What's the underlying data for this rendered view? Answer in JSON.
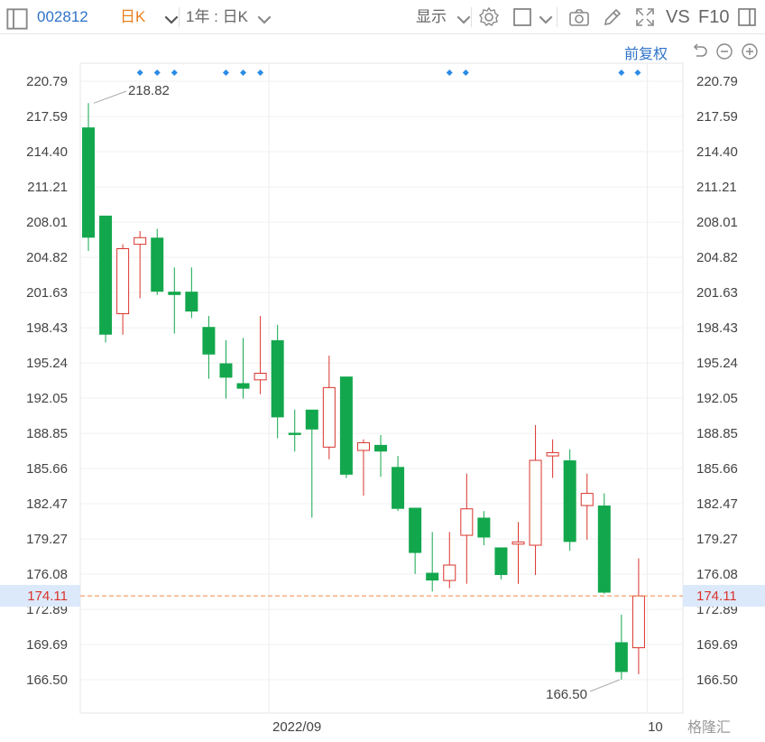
{
  "toolbar": {
    "stock_code": "002812",
    "period": "日K",
    "range": "1年 : 日K",
    "display_label": "显示",
    "vs_label": "VS",
    "f10_label": "F10"
  },
  "adjust_label": "前复权",
  "watermark": "格隆汇",
  "colors": {
    "up": "#d9342b",
    "down": "#13a74d",
    "current_line": "#f0884a",
    "marker": "#2b8be6"
  },
  "chart_data": {
    "type": "candlestick",
    "ylim": [
      165.0,
      222.3
    ],
    "y_ticks": [
      "220.79",
      "217.59",
      "214.40",
      "211.21",
      "208.01",
      "204.82",
      "201.63",
      "198.43",
      "195.24",
      "192.05",
      "188.85",
      "185.66",
      "182.47",
      "179.27",
      "176.08",
      "172.89",
      "169.69",
      "166.50"
    ],
    "x_labels": [
      {
        "label": "2022/09",
        "index": 10.5
      },
      {
        "label": "10",
        "index": 32.5
      }
    ],
    "current_price": "174.11",
    "max_label": "218.82",
    "min_label": "166.50",
    "markers_at": [
      3,
      4,
      5,
      8,
      9,
      10,
      21,
      22,
      31,
      32
    ],
    "candles": [
      {
        "o": 216.6,
        "h": 218.8,
        "l": 205.4,
        "c": 206.6
      },
      {
        "o": 208.6,
        "h": 208.6,
        "l": 197.1,
        "c": 197.8
      },
      {
        "o": 199.7,
        "h": 206.0,
        "l": 197.8,
        "c": 205.6
      },
      {
        "o": 206.0,
        "h": 207.2,
        "l": 201.1,
        "c": 206.6
      },
      {
        "o": 206.6,
        "h": 207.4,
        "l": 201.4,
        "c": 201.7
      },
      {
        "o": 201.7,
        "h": 203.9,
        "l": 197.9,
        "c": 201.4
      },
      {
        "o": 201.7,
        "h": 203.9,
        "l": 199.3,
        "c": 199.9
      },
      {
        "o": 198.5,
        "h": 199.5,
        "l": 193.8,
        "c": 196.0
      },
      {
        "o": 195.2,
        "h": 197.3,
        "l": 192.0,
        "c": 193.9
      },
      {
        "o": 193.4,
        "h": 197.5,
        "l": 192.0,
        "c": 192.9
      },
      {
        "o": 193.7,
        "h": 199.5,
        "l": 192.4,
        "c": 194.3
      },
      {
        "o": 197.3,
        "h": 198.7,
        "l": 188.4,
        "c": 190.3
      },
      {
        "o": 188.9,
        "h": 191.0,
        "l": 187.2,
        "c": 188.7
      },
      {
        "o": 191.0,
        "h": 191.0,
        "l": 181.2,
        "c": 189.2
      },
      {
        "o": 187.6,
        "h": 195.9,
        "l": 186.5,
        "c": 193.0
      },
      {
        "o": 194.0,
        "h": 194.0,
        "l": 184.8,
        "c": 185.1
      },
      {
        "o": 187.3,
        "h": 188.3,
        "l": 183.2,
        "c": 188.0
      },
      {
        "o": 187.8,
        "h": 188.7,
        "l": 184.9,
        "c": 187.2
      },
      {
        "o": 185.8,
        "h": 186.8,
        "l": 181.8,
        "c": 182.0
      },
      {
        "o": 182.1,
        "h": 182.1,
        "l": 176.1,
        "c": 178.0
      },
      {
        "o": 176.2,
        "h": 179.9,
        "l": 174.5,
        "c": 175.5
      },
      {
        "o": 175.5,
        "h": 179.9,
        "l": 174.8,
        "c": 176.9
      },
      {
        "o": 179.6,
        "h": 185.2,
        "l": 175.2,
        "c": 182.0
      },
      {
        "o": 181.2,
        "h": 181.8,
        "l": 178.7,
        "c": 179.4
      },
      {
        "o": 178.5,
        "h": 178.5,
        "l": 175.6,
        "c": 176.0
      },
      {
        "o": 178.8,
        "h": 180.8,
        "l": 175.2,
        "c": 179.0
      },
      {
        "o": 178.7,
        "h": 189.6,
        "l": 176.0,
        "c": 186.4
      },
      {
        "o": 186.8,
        "h": 188.3,
        "l": 184.8,
        "c": 187.1
      },
      {
        "o": 186.4,
        "h": 187.4,
        "l": 178.2,
        "c": 179.0
      },
      {
        "o": 182.3,
        "h": 185.2,
        "l": 179.2,
        "c": 183.4
      },
      {
        "o": 182.3,
        "h": 183.4,
        "l": 174.3,
        "c": 174.4
      },
      {
        "o": 169.9,
        "h": 172.4,
        "l": 166.5,
        "c": 167.2
      },
      {
        "o": 169.4,
        "h": 177.5,
        "l": 167.0,
        "c": 174.1
      }
    ]
  }
}
